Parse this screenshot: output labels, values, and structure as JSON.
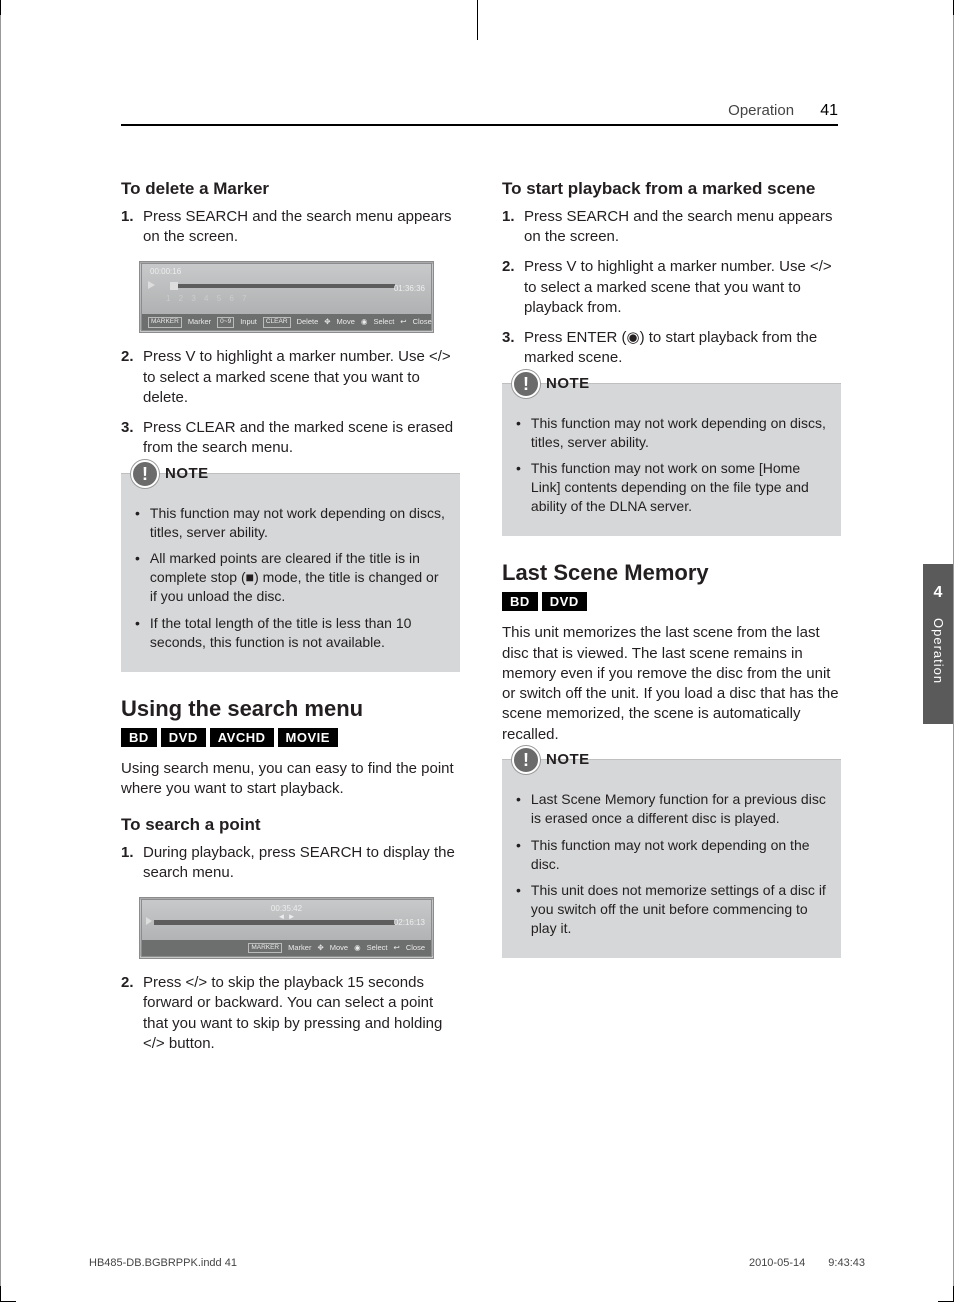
{
  "header": {
    "section": "Operation",
    "page_number": "41"
  },
  "side_tab": {
    "chapter_number": "4",
    "label": "Operation"
  },
  "left": {
    "h_delete_marker": "To delete a Marker",
    "delete_steps": [
      "Press SEARCH and the search menu appears on the screen.",
      "Press V to highlight a marker number. Use </> to select a marked scene that you want to delete.",
      "Press CLEAR and the marked scene is erased from the search menu."
    ],
    "note1_label": "NOTE",
    "note1_items": [
      "This function may not work depending on discs, titles, server ability.",
      "All marked points are cleared if the title is in complete stop (■) mode, the title is changed or if you unload the disc.",
      "If the total length of the title is less than 10 seconds, this function is not available."
    ],
    "h_using_search": "Using the search menu",
    "search_tags": [
      "BD",
      "DVD",
      "AVCHD",
      "MOVIE"
    ],
    "search_intro": "Using search menu, you can easy to find the point where you want to start playback.",
    "h_search_point": "To search a point",
    "search_steps": [
      "During playback, press SEARCH to display the search menu.",
      "Press </> to skip the playback 15 seconds forward or backward. You can select a point that you want to skip by pressing and holding </> button."
    ],
    "ss1": {
      "time_l": "00:00:16",
      "time_r": "01:36:36",
      "markers": "1  2  3    4 5    6  7",
      "ctrl": {
        "m": "MARKER",
        "marker": "Marker",
        "i": "0~9",
        "input": "Input",
        "c": "CLEAR",
        "delete": "Delete",
        "move": "Move",
        "select": "Select",
        "close": "Close"
      }
    },
    "ss2": {
      "time_c": "00:35:42",
      "time_r": "02:16:13",
      "lr": "◄ ►",
      "ctrl": {
        "m": "MARKER",
        "marker": "Marker",
        "move": "Move",
        "select": "Select",
        "close": "Close"
      }
    }
  },
  "right": {
    "h_start_playback": "To start playback from a marked scene",
    "start_steps": [
      "Press SEARCH and the search menu appears on the screen.",
      "Press V to highlight a marker number. Use </> to select a marked scene that you want to playback from.",
      "Press ENTER (◉) to start playback from the marked scene."
    ],
    "note2_label": "NOTE",
    "note2_items": [
      "This function may not work depending on discs, titles, server ability.",
      "This function may not work on some [Home Link] contents depending on the file type and ability of the DLNA server."
    ],
    "h_last_scene": "Last Scene Memory",
    "last_scene_tags": [
      "BD",
      "DVD"
    ],
    "last_scene_para": "This unit memorizes the last scene from the last disc that is viewed. The last scene remains in memory even if you remove the disc from the unit or switch off the unit. If you load a disc that has the scene memorized, the scene is automatically recalled.",
    "note3_label": "NOTE",
    "note3_items": [
      "Last Scene Memory function for a previous disc is erased once a different disc is played.",
      "This function may not work depending on the disc.",
      "This unit does not memorize settings of a disc if you switch off the unit before commencing to play it."
    ]
  },
  "footer": {
    "file": "HB485-DB.BGBRPPK.indd   41",
    "date": "2010-05-14",
    "time": "9:43:43"
  }
}
